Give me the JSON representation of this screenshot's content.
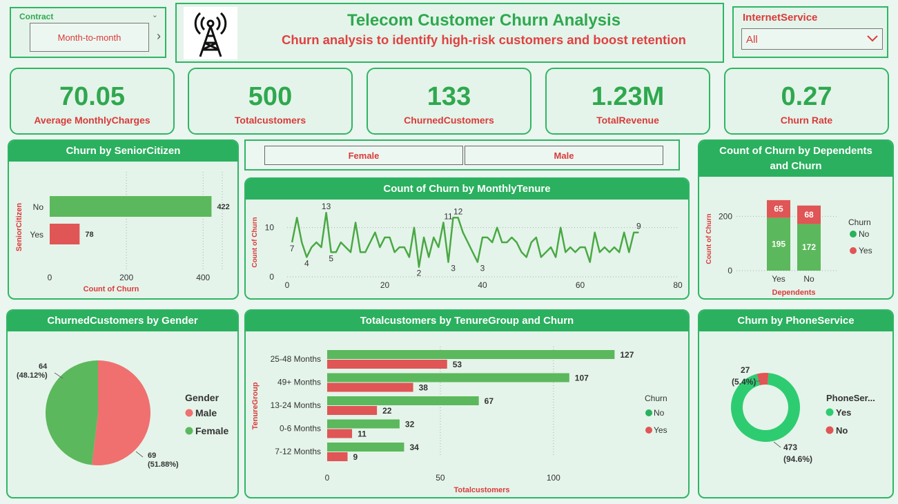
{
  "contract": {
    "label": "Contract",
    "value": "Month-to-month"
  },
  "header": {
    "title": "Telecom Customer Churn Analysis",
    "subtitle": "Churn analysis to identify high-risk customers and boost retention"
  },
  "internet": {
    "label": "InternetService",
    "value": "All"
  },
  "kpis": [
    {
      "value": "70.05",
      "label": "Average MonthlyCharges"
    },
    {
      "value": "500",
      "label": "Totalcustomers"
    },
    {
      "value": "133",
      "label": "ChurnedCustomers"
    },
    {
      "value": "1.23M",
      "label": "TotalRevenue"
    },
    {
      "value": "0.27",
      "label": "Churn Rate"
    }
  ],
  "gender_slicer": {
    "options": [
      "Female",
      "Male"
    ]
  },
  "colors": {
    "green": "#5cb85c",
    "red": "#e05555",
    "accent": "#2ab05e",
    "donut_green": "#2ecc71"
  },
  "chart_data": [
    {
      "id": "senior",
      "type": "bar",
      "title": "Churn by SeniorCitizen",
      "xlabel": "Count of Churn",
      "ylabel": "SeniorCitizen",
      "categories": [
        "No",
        "Yes"
      ],
      "values": [
        422,
        78
      ],
      "xticks": [
        "0",
        "200",
        "400"
      ],
      "xlim": [
        0,
        450
      ]
    },
    {
      "id": "tenure",
      "type": "line",
      "title": "Count of Churn by MonthlyTenure",
      "ylabel": "Count of Churn",
      "xticks": [
        "0",
        "20",
        "40",
        "60",
        "80"
      ],
      "yticks": [
        "0",
        "10"
      ],
      "xlim": [
        0,
        80
      ],
      "ylim": [
        0,
        14
      ],
      "x": [
        1,
        2,
        3,
        4,
        5,
        6,
        7,
        8,
        9,
        10,
        11,
        12,
        13,
        14,
        15,
        16,
        17,
        18,
        19,
        20,
        21,
        22,
        23,
        24,
        25,
        26,
        27,
        28,
        29,
        30,
        31,
        32,
        33,
        34,
        35,
        36,
        37,
        38,
        39,
        40,
        41,
        42,
        43,
        44,
        45,
        46,
        47,
        48,
        49,
        50,
        51,
        52,
        53,
        54,
        55,
        56,
        57,
        58,
        59,
        60,
        61,
        62,
        63,
        64,
        65,
        66,
        67,
        68,
        69,
        70,
        71,
        72
      ],
      "y": [
        7,
        12,
        7,
        4,
        6,
        7,
        6,
        13,
        5,
        5,
        7,
        6,
        5,
        11,
        5,
        5,
        7,
        9,
        6,
        8,
        8,
        5,
        6,
        6,
        4,
        10,
        2,
        8,
        4,
        8,
        6,
        11,
        3,
        12,
        12,
        9,
        7,
        5,
        3,
        8,
        8,
        7,
        10,
        7,
        7,
        8,
        7,
        5,
        4,
        7,
        8,
        4,
        5,
        6,
        4,
        10,
        5,
        6,
        5,
        6,
        6,
        3,
        9,
        5,
        6,
        5,
        6,
        5,
        9,
        5,
        9,
        9
      ],
      "labels": [
        {
          "x": 1,
          "y": 7,
          "text": "7"
        },
        {
          "x": 4,
          "y": 4,
          "text": "4"
        },
        {
          "x": 8,
          "y": 13,
          "text": "13"
        },
        {
          "x": 9,
          "y": 5,
          "text": "5"
        },
        {
          "x": 27,
          "y": 2,
          "text": "2"
        },
        {
          "x": 33,
          "y": 11,
          "text": "11"
        },
        {
          "x": 34,
          "y": 3,
          "text": "3"
        },
        {
          "x": 35,
          "y": 12,
          "text": "12"
        },
        {
          "x": 40,
          "y": 3,
          "text": "3"
        },
        {
          "x": 72,
          "y": 9,
          "text": "9"
        }
      ]
    },
    {
      "id": "dependents",
      "type": "bar",
      "title": "Count of Churn by Dependents and Churn",
      "xlabel": "Dependents",
      "ylabel": "Count of Churn",
      "categories": [
        "Yes",
        "No"
      ],
      "series": [
        {
          "name": "No",
          "values": [
            195,
            172
          ]
        },
        {
          "name": "Yes",
          "values": [
            65,
            68
          ]
        }
      ],
      "yticks": [
        "0",
        "200"
      ],
      "ylim": [
        0,
        280
      ],
      "legend_title": "Churn"
    },
    {
      "id": "gender",
      "type": "pie",
      "title": "ChurnedCustomers by Gender",
      "legend_title": "Gender",
      "slices": [
        {
          "name": "Male",
          "value": 69,
          "label": "69",
          "pct": "(51.88%)"
        },
        {
          "name": "Female",
          "value": 64,
          "label": "64",
          "pct": "(48.12%)"
        }
      ]
    },
    {
      "id": "tenuregroup",
      "type": "bar",
      "title": "Totalcustomers by TenureGroup and Churn",
      "xlabel": "Totalcustomers",
      "ylabel": "TenureGroup",
      "categories": [
        "25-48 Months",
        "49+ Months",
        "13-24 Months",
        "0-6 Months",
        "7-12 Months"
      ],
      "series": [
        {
          "name": "No",
          "values": [
            127,
            107,
            67,
            32,
            34
          ]
        },
        {
          "name": "Yes",
          "values": [
            53,
            38,
            22,
            11,
            9
          ]
        }
      ],
      "xticks": [
        "0",
        "50",
        "100"
      ],
      "xlim": [
        0,
        140
      ],
      "legend_title": "Churn"
    },
    {
      "id": "phone",
      "type": "pie",
      "title": "Churn by PhoneService",
      "legend_title": "PhoneSer...",
      "slices": [
        {
          "name": "Yes",
          "value": 473,
          "label": "473",
          "pct": "(94.6%)"
        },
        {
          "name": "No",
          "value": 27,
          "label": "27",
          "pct": "(5.4%)"
        }
      ]
    }
  ]
}
